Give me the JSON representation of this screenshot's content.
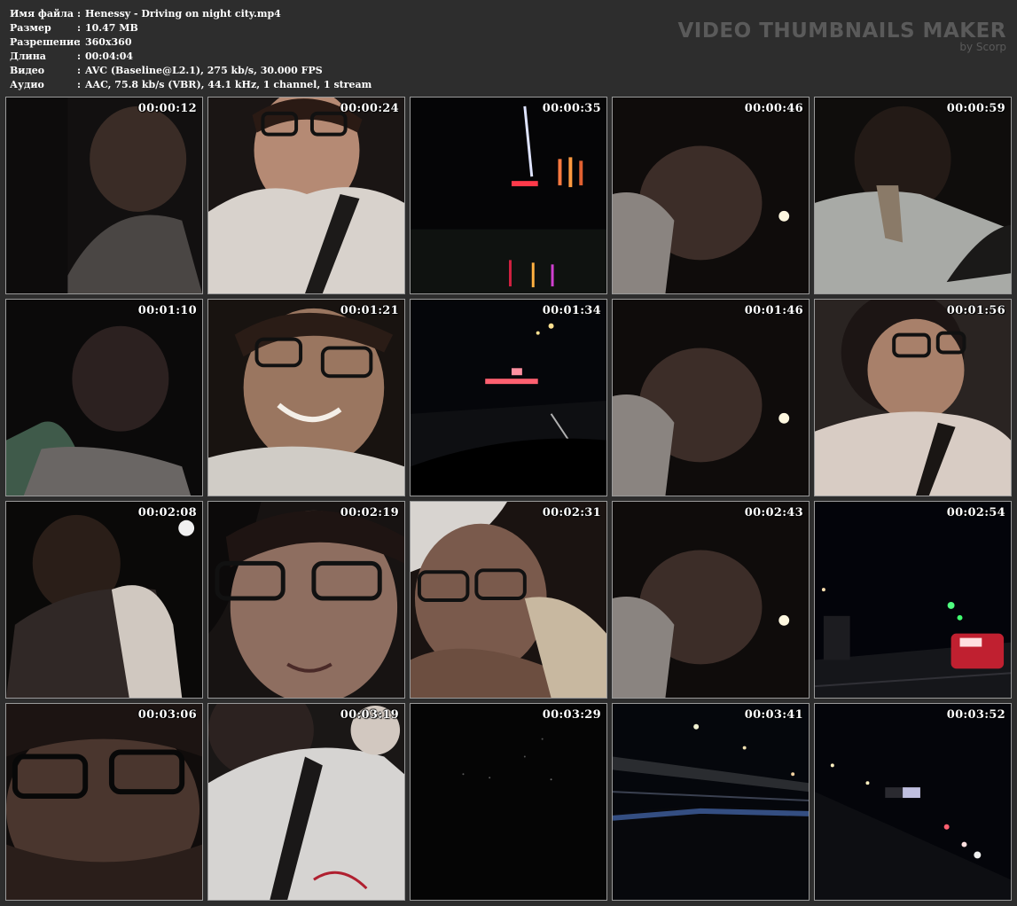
{
  "info": {
    "rows": [
      {
        "key": "Имя файла",
        "value": "Henessy - Driving on night city.mp4"
      },
      {
        "key": "Размер",
        "value": "10.47 MB"
      },
      {
        "key": "Разрешение",
        "value": "360x360"
      },
      {
        "key": "Длина",
        "value": "00:04:04"
      },
      {
        "key": "Видео",
        "value": "AVC (Baseline@L2.1), 275 kb/s, 30.000 FPS"
      },
      {
        "key": "Аудио",
        "value": "AAC, 75.8 kb/s (VBR), 44.1 kHz, 1 channel, 1 stream"
      }
    ],
    "separator": ":"
  },
  "brand": {
    "title": "VIDEO THUMBNAILS MAKER",
    "subtitle": "by Scorp",
    "color": "#5a5a5a"
  },
  "thumbnails": [
    {
      "time": "00:00:12",
      "scene": "face-dark"
    },
    {
      "time": "00:00:24",
      "scene": "face-glasses-bright"
    },
    {
      "time": "00:00:35",
      "scene": "road-night-lights"
    },
    {
      "time": "00:00:46",
      "scene": "face-dark-side"
    },
    {
      "time": "00:00:59",
      "scene": "peace-sign"
    },
    {
      "time": "00:01:10",
      "scene": "face-bottle"
    },
    {
      "time": "00:01:21",
      "scene": "face-smile-glasses"
    },
    {
      "time": "00:01:34",
      "scene": "road-street-lights"
    },
    {
      "time": "00:01:46",
      "scene": "face-dark-side"
    },
    {
      "time": "00:01:56",
      "scene": "profile-glasses"
    },
    {
      "time": "00:02:08",
      "scene": "face-dark-light"
    },
    {
      "time": "00:02:19",
      "scene": "face-glasses-close"
    },
    {
      "time": "00:02:31",
      "scene": "face-laughing-hand"
    },
    {
      "time": "00:02:43",
      "scene": "face-dark-side"
    },
    {
      "time": "00:02:54",
      "scene": "road-green-light-car"
    },
    {
      "time": "00:03:06",
      "scene": "face-glasses-closeup"
    },
    {
      "time": "00:03:19",
      "scene": "shirt-belt"
    },
    {
      "time": "00:03:29",
      "scene": "black-dots"
    },
    {
      "time": "00:03:41",
      "scene": "road-bridge-lights"
    },
    {
      "time": "00:03:52",
      "scene": "road-diagonal-lights"
    }
  ]
}
